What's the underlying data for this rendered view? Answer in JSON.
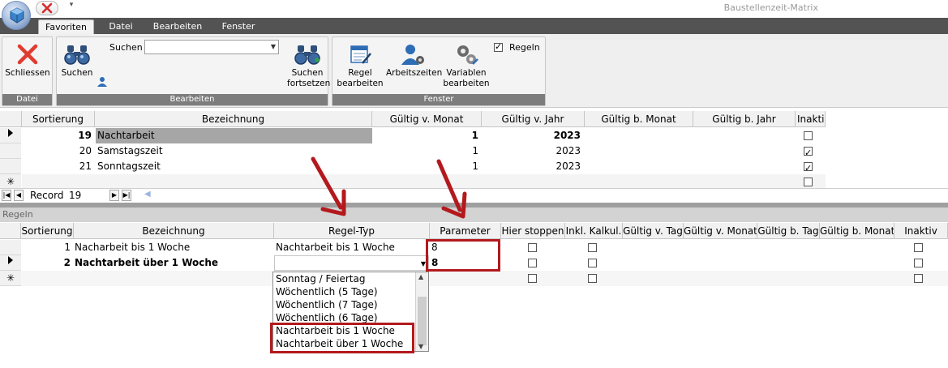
{
  "window": {
    "title": "Baustellenzeit-Matrix"
  },
  "ribbon": {
    "tabs": [
      {
        "label": "Favoriten",
        "active": true
      },
      {
        "label": "Datei",
        "active": false
      },
      {
        "label": "Bearbeiten",
        "active": false
      },
      {
        "label": "Fenster",
        "active": false
      }
    ],
    "groups": {
      "datei": {
        "label": "Datei",
        "close_label": "Schliessen"
      },
      "bearbeiten": {
        "label": "Bearbeiten",
        "search_label": "Suchen",
        "search_button": "Suchen",
        "search_value": "",
        "continue_line1": "Suchen",
        "continue_line2": "fortsetzen"
      },
      "fenster": {
        "label": "Fenster",
        "rule_edit_line1": "Regel",
        "rule_edit_line2": "bearbeiten",
        "worktimes": "Arbeitszeiten",
        "variables_line1": "Variablen",
        "variables_line2": "bearbeiten",
        "regeln_checkbox_label": "Regeln",
        "regeln_checked": true
      }
    }
  },
  "upper_grid": {
    "columns": [
      "Sortierung",
      "Bezeichnung",
      "Gültig v. Monat",
      "Gültig v. Jahr",
      "Gültig b. Monat",
      "Gültig b. Jahr",
      "Inakti"
    ],
    "rows": [
      {
        "sortierung": "19",
        "bezeichnung": "Nachtarbeit",
        "gv_monat": "1",
        "gv_jahr": "2023",
        "gb_monat": "",
        "gb_jahr": "",
        "inaktiv": false,
        "current": true
      },
      {
        "sortierung": "20",
        "bezeichnung": "Samstagszeit",
        "gv_monat": "1",
        "gv_jahr": "2023",
        "gb_monat": "",
        "gb_jahr": "",
        "inaktiv": true,
        "current": false
      },
      {
        "sortierung": "21",
        "bezeichnung": "Sonntagszeit",
        "gv_monat": "1",
        "gv_jahr": "2023",
        "gb_monat": "",
        "gb_jahr": "",
        "inaktiv": true,
        "current": false
      }
    ],
    "new_row_marker": "✳"
  },
  "navigator": {
    "record_label": "Record",
    "record_value": "19"
  },
  "lower_section": {
    "title": "Regeln"
  },
  "lower_grid": {
    "columns": [
      "Sortierung",
      "Bezeichnung",
      "Regel-Typ",
      "Parameter",
      "Hier stoppen",
      "Inkl. Kalkul.",
      "Gültig v. Tag",
      "Gültig v. Monat",
      "Gültig b. Tag",
      "Gültig b. Monat",
      "Inaktiv"
    ],
    "rows": [
      {
        "sortierung": "1",
        "bezeichnung": "Nacharbeit bis 1 Woche",
        "regel_typ": "Nachtarbeit bis 1 Woche",
        "parameter": "8",
        "current": false
      },
      {
        "sortierung": "2",
        "bezeichnung": "Nachtarbeit über 1 Woche",
        "regel_typ": "",
        "parameter": "8",
        "current": true
      }
    ],
    "new_row_marker": "✳"
  },
  "regel_typ_dropdown": {
    "options": [
      "Sonntag / Feiertag",
      "Wöchentlich (5 Tage)",
      "Wöchentlich (7 Tage)",
      "Wöchentlich (6 Tage)",
      "Nachtarbeit bis 1 Woche",
      "Nachtarbeit über 1 Woche"
    ]
  },
  "colors": {
    "annotation_red": "#b3191d",
    "ribbon_label_bg": "#7d7d7d",
    "tabstrip_bg": "#535353"
  }
}
